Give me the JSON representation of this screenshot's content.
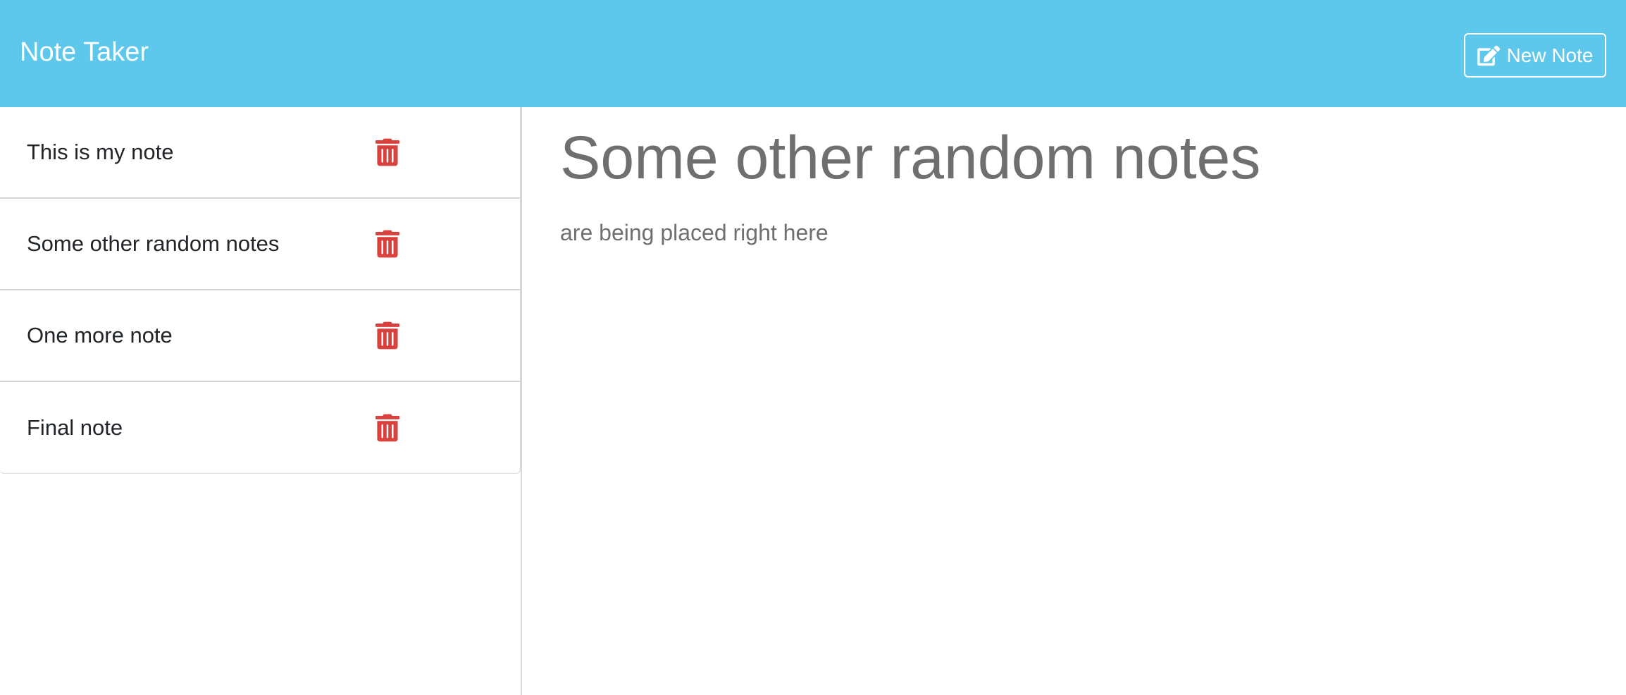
{
  "navbar": {
    "brand": "Note Taker",
    "new_note_label": "New Note",
    "new_note_icon": "edit-icon",
    "background_color": "#5dc7ec"
  },
  "sidebar": {
    "notes": [
      {
        "title": "This is my note",
        "delete_icon": "trash-icon"
      },
      {
        "title": "Some other random notes",
        "delete_icon": "trash-icon"
      },
      {
        "title": "One more note",
        "delete_icon": "trash-icon"
      },
      {
        "title": "Final note",
        "delete_icon": "trash-icon"
      }
    ],
    "delete_color": "#d9413f"
  },
  "main": {
    "note_title": "Some other random notes",
    "note_text": "are being placed right here"
  }
}
